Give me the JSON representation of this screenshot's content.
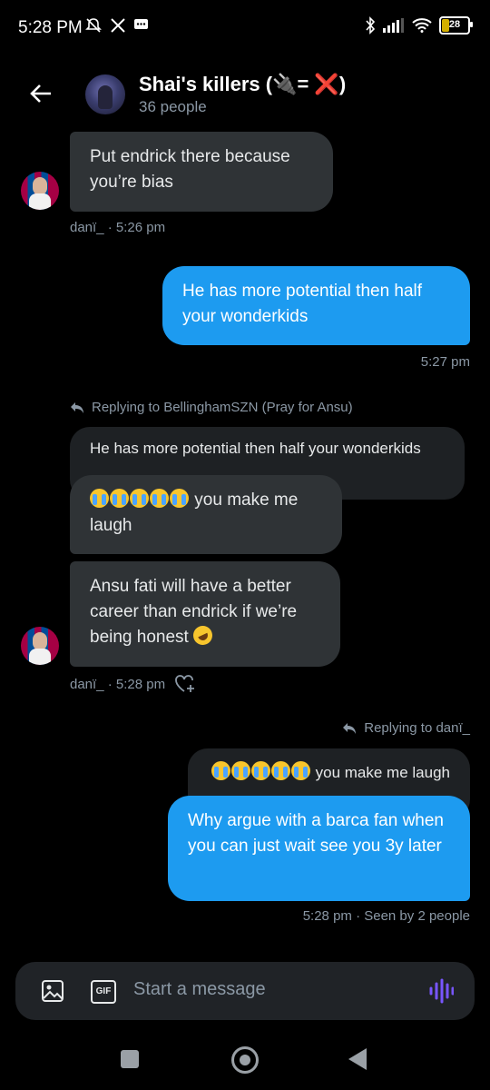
{
  "status_bar": {
    "time": "5:28 PM",
    "battery": "28",
    "left_icons": [
      "mute-icon",
      "x-logo-icon",
      "message-icon"
    ],
    "right_icons": [
      "bluetooth-icon",
      "signal-icon",
      "wifi-icon",
      "battery-icon"
    ]
  },
  "header": {
    "title": "Shai's killers (🔌= ❌)",
    "member_count": "36 people"
  },
  "messages": {
    "m1": {
      "text": "Put endrick there because you’re bias",
      "meta": "danï_ · 5:26 pm"
    },
    "m2": {
      "text": "He has more potential then half your wonderkids",
      "meta": "5:27 pm"
    },
    "m3": {
      "replying": "Replying to BellinghamSZN (Pray for Ansu)",
      "quoted": "He has more potential then half your wonderkids",
      "text": "you make me laugh"
    },
    "m4": {
      "text": "Ansu fati will have a better career than endrick if we’re being honest",
      "meta": "danï_ · 5:28 pm"
    },
    "m5": {
      "replying": "Replying to danï_",
      "quoted": "you make me laugh",
      "text": "Why argue with a barca fan when you can just wait see you 3y later",
      "meta": "5:28 pm · Seen by 2 people"
    }
  },
  "composer": {
    "placeholder": "Start a message",
    "gif_label": "GIF"
  },
  "colors": {
    "accent": "#1d9bf0",
    "incoming_bubble": "#2f3336",
    "voice_icon": "#7856ff"
  }
}
